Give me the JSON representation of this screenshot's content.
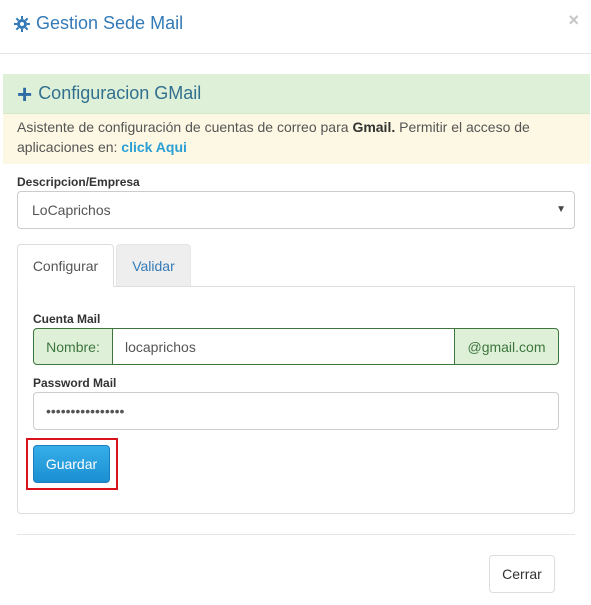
{
  "modal": {
    "title": "Gestion Sede Mail",
    "close_label": "×"
  },
  "panel": {
    "heading": "Configuracion GMail",
    "note_prefix": "Asistente de configuración de cuentas de correo para ",
    "note_bold": "Gmail.",
    "note_middle": " Permitir el acceso de aplicaciones en: ",
    "note_link": "click Aqui"
  },
  "form": {
    "empresa_label": "Descripcion/Empresa",
    "empresa_value": "LoCaprichos",
    "tabs": [
      {
        "label": "Configurar",
        "active": true
      },
      {
        "label": "Validar",
        "active": false
      }
    ],
    "cuenta_label": "Cuenta Mail",
    "cuenta_prefix": "Nombre:",
    "cuenta_value": "locaprichos",
    "cuenta_suffix": "@gmail.com",
    "password_label": "Password Mail",
    "password_value": "••••••••••••••••",
    "save_label": "Guardar"
  },
  "footer": {
    "close_label": "Cerrar"
  },
  "colors": {
    "primary": "#337ab7",
    "success_bg": "#dff0d8",
    "success_border": "#3c763d",
    "warning_bg": "#fcf8e3",
    "highlight": "#d9121b"
  }
}
